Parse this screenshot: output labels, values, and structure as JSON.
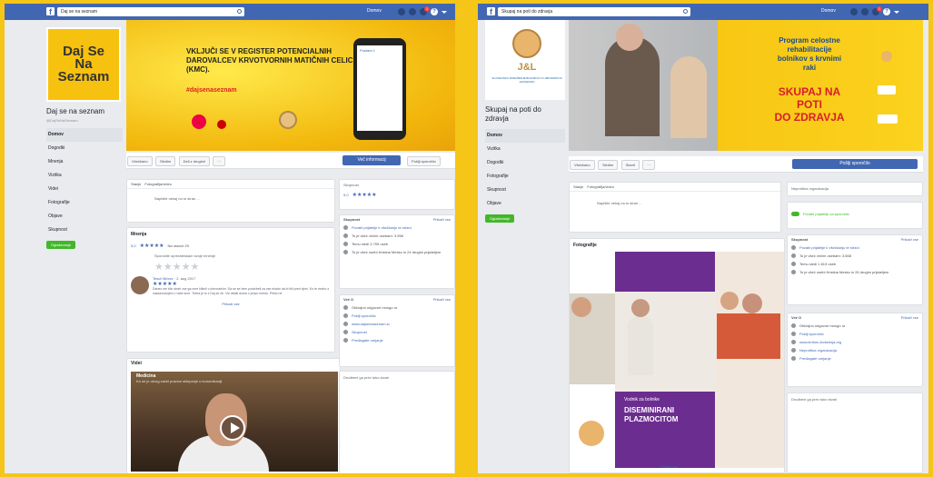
{
  "left": {
    "search_value": "Daj se na seznam",
    "home": "Domov",
    "badge": "1",
    "logo_text": "Daj Se Na Seznam",
    "page_name": "Daj se na seznam",
    "page_handle": "@DajSeNaSeznam",
    "nav": [
      "Domov",
      "Dogodki",
      "Mnenja",
      "Vizitka",
      "Videi",
      "Fotografije",
      "Objave",
      "Skupnost"
    ],
    "promote": "Oglaševanje",
    "cover": {
      "headline": "VKLJUČI SE V REGISTER POTENCIALNIH DAROVALCEV KRVOTVORNIH MATIČNIH CELIC (KMC).",
      "hashtag": "#dajsenaseznam",
      "phone_label": "Postani č"
    },
    "actions": {
      "like": "Všečkano",
      "follow": "Sledim",
      "share": "Deli z drugimi",
      "more": "···",
      "primary": "Več informacij",
      "message": "Pošlji sporočilo"
    },
    "composer": {
      "tab1": "Stanje",
      "tab2": "Fotografija/video",
      "placeholder": "Napišite nekaj na to stran ..."
    },
    "reviews": {
      "title": "Mnenja",
      "score": "5,0",
      "out_of": "Na osnovi 29",
      "prompt": "Sporočite oprerateskam svoje mnenje",
      "reviewer": "Tesch Bricev",
      "date": "2. aug 2017",
      "text": "Danes me bilo strah vse ga cere kliknil v donoralnim. Da se se bem poskrbeli za vse mlado da bi bili pred njimi. Ko te vedno z nakazovanjem v vaše srce. Treba je to z Daj se že. Vsi delati doma v pravo mesto. Prišlo ne",
      "more": "Preberi več",
      "see_all": "Prikaži vse"
    },
    "videos": {
      "title": "Videi",
      "label": "Medicina",
      "sub": "Ko se je okrog začel pravice sklepanje o komunikaciji"
    },
    "right": {
      "community_rating": "Skupnost",
      "score": "5,0",
      "community": "Skupnost",
      "invite": "Prikaži vse",
      "rows": [
        "Povabi prijatelje k všečkanju te strani",
        "To je všeč večim osebam: 3.956",
        "Temu sledi 3.799 oseb",
        "To je všeč osebi Kristina Mesko in 24 drugim prijateljem"
      ],
      "about": "Več O",
      "about_see": "Prikaži vse",
      "about_rows": [
        "Običajno odgovori mnogo ur",
        "Pošlji sporočilo",
        "www.dajsenaseznam.si",
        "Skupnost",
        "Predlagate urejanje"
      ],
      "footer": "Drudbeni ga prev tuko stvari"
    }
  },
  "right_panel": {
    "search_value": "Skupaj na poti do zdravja",
    "home": "Domov",
    "badge": "1",
    "logo_text": "J&L",
    "logo_sub": "SLOVENSKO ZDRUŽENJE BOLNIKOV Z LIMFOMOM IN LEVKEMIJO",
    "page_name": "Skupaj na poti do zdravja",
    "nav": [
      "Domov",
      "Vizitka",
      "Dogodki",
      "Fotografije",
      "Skupnost",
      "Objave"
    ],
    "promote": "Oglaševanje",
    "cover": {
      "line1": "Program celostne",
      "line2": "rehabilitacije",
      "line3": "bolnikov s krvnimi",
      "line4": "raki",
      "big1": "SKUPAJ NA",
      "big2": "POTI",
      "big3": "DO ZDRAVJA"
    },
    "actions": {
      "like": "Všečkano",
      "follow": "Sledim",
      "share": "Stanit",
      "more": "···",
      "primary": "Pošlji sporočilo"
    },
    "composer": {
      "tab1": "Stanje",
      "tab2": "Fotografija/video",
      "placeholder": "Napišite nekaj na to stran ..."
    },
    "photos": {
      "title": "Fotografije",
      "b1": "Vodnik za bolnike",
      "b2": "DISEMINIRANI PLAZMOCITOM",
      "more": "Prikaži vse"
    },
    "side": {
      "org": "Neprofitna organizacija",
      "invite": "Povabi prijatelje za sporočilo",
      "community": "Skupnost",
      "see_all": "Prikaži vse",
      "rows": [
        "Povabi prijatelje k všečkanju te strani",
        "To je všeč večim osebam: 3.668",
        "Temu sledi 1.613 oseb",
        "To je všeč osebi Kristina Mesko in 26 drugim prijateljem"
      ],
      "about": "Več O",
      "about_see": "Prikaži vse",
      "about_rows": [
        "Običajno odgovori mnogo ur",
        "Pošlji sporočilo",
        "www.limfom-levkemija.org",
        "Neprofitna organizacija",
        "Predlagate urejanje"
      ],
      "footer": "Drudbeni ga prev tuko stvari"
    }
  },
  "colors": {
    "fb_blue": "#4267b2",
    "frame": "#f5c518",
    "purple": "#6b2d8f",
    "green": "#42b72a"
  }
}
